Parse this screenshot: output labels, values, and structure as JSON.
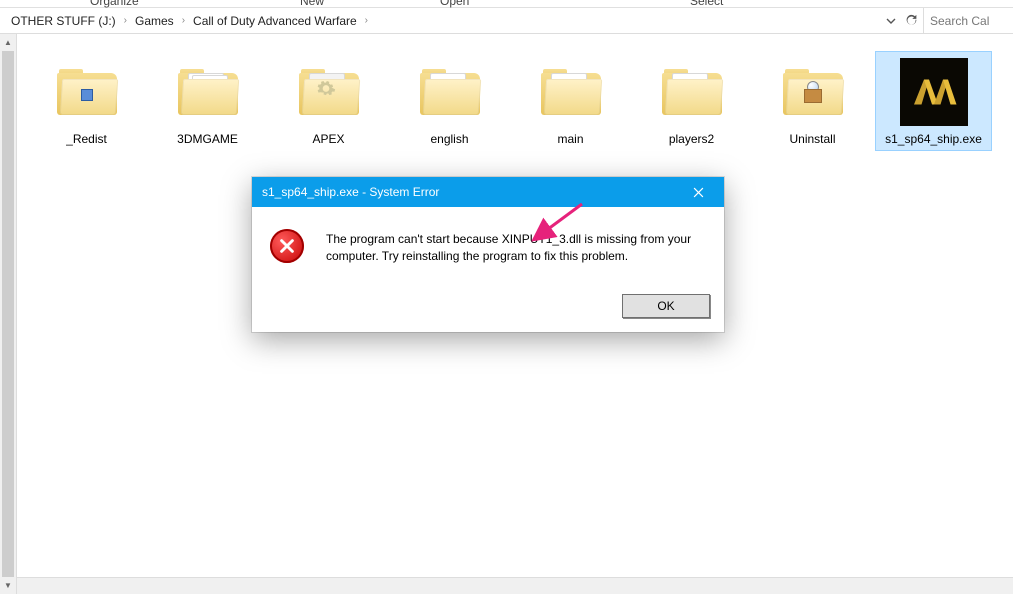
{
  "toolbar": {
    "clip1": "Organize",
    "clip2": "New",
    "clip3": "Open",
    "clip4": "Select"
  },
  "breadcrumb": {
    "items": [
      "OTHER STUFF (J:)",
      "Games",
      "Call of Duty Advanced Warfare"
    ]
  },
  "search": {
    "placeholder": "Search Cal"
  },
  "files": [
    {
      "label": "_Redist",
      "type": "folder",
      "variant": "paper-img"
    },
    {
      "label": "3DMGAME",
      "type": "folder",
      "variant": "paper-text"
    },
    {
      "label": "APEX",
      "type": "folder",
      "variant": "gear"
    },
    {
      "label": "english",
      "type": "folder",
      "variant": "empty-open"
    },
    {
      "label": "main",
      "type": "folder",
      "variant": "empty-open"
    },
    {
      "label": "players2",
      "type": "folder",
      "variant": "empty-open"
    },
    {
      "label": "Uninstall",
      "type": "folder",
      "variant": "uninstall"
    },
    {
      "label": "s1_sp64_ship.exe",
      "type": "exe",
      "variant": "aw",
      "selected": true
    }
  ],
  "dialog": {
    "title": "s1_sp64_ship.exe - System Error",
    "message": "The program can't start because XINPUT1_3.dll is missing from your computer. Try reinstalling the program to fix this problem.",
    "ok_label": "OK"
  }
}
